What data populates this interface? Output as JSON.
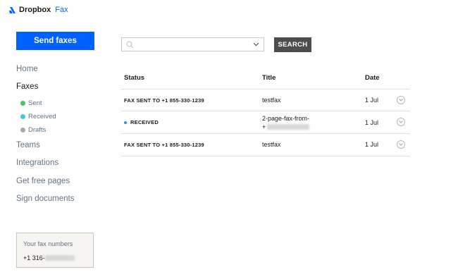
{
  "app": {
    "brand": "Dropbox",
    "product": "Fax"
  },
  "sidebar": {
    "send_label": "Send faxes",
    "items": [
      {
        "label": "Home"
      },
      {
        "label": "Faxes"
      },
      {
        "label": "Teams"
      },
      {
        "label": "Integrations"
      },
      {
        "label": "Get free pages"
      },
      {
        "label": "Sign documents"
      }
    ],
    "sub_items": [
      {
        "label": "Sent",
        "color": "#4fbf67"
      },
      {
        "label": "Received",
        "color": "#4fc3dc"
      },
      {
        "label": "Drafts",
        "color": "#a8a8a8"
      }
    ],
    "fax_box": {
      "label": "Your fax numbers",
      "number_prefix": "+1 316-"
    }
  },
  "search": {
    "placeholder": "",
    "button_label": "SEARCH"
  },
  "table": {
    "headers": {
      "status": "Status",
      "title": "Title",
      "date": "Date"
    },
    "rows": [
      {
        "status": "FAX SENT TO +1 855-330-1239",
        "title": "testfax",
        "date": "1 Jul"
      },
      {
        "status": "RECEIVED",
        "title_line1": "2-page-fax-from-",
        "title_line2_prefix": "+",
        "date": "1 Jul"
      },
      {
        "status": "FAX SENT TO +1 855-330-1239",
        "title": "testfax",
        "date": "1 Jul"
      }
    ]
  },
  "colors": {
    "accent": "#0061fe",
    "search_button": "#4d4d4d"
  }
}
